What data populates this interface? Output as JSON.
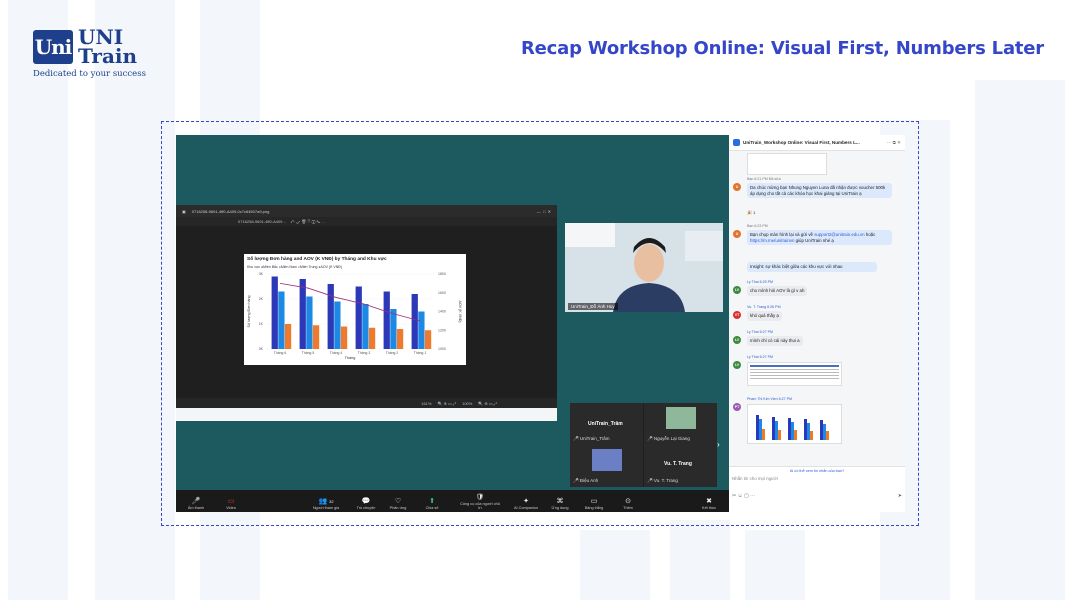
{
  "brand": {
    "logo_mark": "Uni",
    "logo_line1": "UNI",
    "logo_line2": "Train",
    "tagline": "Dedicated to your success"
  },
  "page_title": "Recap Workshop Online: Visual First, Numbers Later",
  "viewer": {
    "file_name": "0716258-9691-4ff0-A409-0c7c64507a9.png",
    "tab_name": "0716258-9691-4ff0-A409…",
    "zoom_left": "161%",
    "zoom_right": "100%"
  },
  "chart_data": {
    "type": "bar",
    "title": "Số lượng Đơn hàng and AOV (K VNĐ) by Tháng and Khu vực",
    "legend_title": "Khu vực",
    "categories": [
      "Tháng 6",
      "Tháng 5",
      "Tháng 4",
      "Tháng 3",
      "Tháng 2",
      "Tháng 1"
    ],
    "series": [
      {
        "name": "Miền Bắc",
        "values": [
          2.9,
          2.8,
          2.6,
          2.5,
          2.3,
          2.2
        ]
      },
      {
        "name": "Miền Nam",
        "values": [
          2.3,
          2.1,
          1.9,
          1.8,
          1.6,
          1.5
        ]
      },
      {
        "name": "Miền Trung",
        "values": [
          1.0,
          0.95,
          0.9,
          0.85,
          0.8,
          0.75
        ]
      }
    ],
    "line": {
      "name": "AOV (K VNĐ)",
      "values": [
        1700,
        1650,
        1550,
        1480,
        1380,
        1300
      ]
    },
    "xlabel": "Tháng",
    "ylabel": "Số lượng Đơn hàng",
    "y2label": "AOV (K VNĐ)",
    "y_ticks": [
      "0K",
      "1K",
      "2K",
      "3K"
    ],
    "y2_ticks": [
      "1000",
      "1200",
      "1400",
      "1600",
      "1800"
    ],
    "colors": {
      "Miền Bắc": "#2b39b8",
      "Miền Nam": "#1e88e5",
      "Miền Trung": "#f07a2c",
      "AOV (K VNĐ)": "#9c2c7a"
    }
  },
  "camera": {
    "name": "UniTrain_Đỗ Ánh Huy"
  },
  "tiles": [
    {
      "name": "UniTrain_Trâm",
      "label": "UniTrain_Trâm"
    },
    {
      "name": "",
      "label": "Nguyễn Lại Giang"
    },
    {
      "name": "",
      "label": "Điệu Anh"
    },
    {
      "name": "Vu. T. Trang",
      "label": "Vu. T. Trang"
    }
  ],
  "toolbar": [
    {
      "icon": "mic",
      "label": "Âm thanh"
    },
    {
      "icon": "video",
      "label": "Video"
    },
    {
      "icon": "participants",
      "label": "Người tham gia",
      "count": "32"
    },
    {
      "icon": "chat",
      "label": "Trò chuyện"
    },
    {
      "icon": "react",
      "label": "Phản ứng"
    },
    {
      "icon": "share",
      "label": "Chia sẻ"
    },
    {
      "icon": "host",
      "label": "Công cụ của người chủ trì"
    },
    {
      "icon": "ai",
      "label": "AI Companion"
    },
    {
      "icon": "apps",
      "label": "Ứng dụng"
    },
    {
      "icon": "whiteboard",
      "label": "Bảng trắng"
    },
    {
      "icon": "more",
      "label": "Thêm"
    },
    {
      "icon": "end",
      "label": "Kết thúc"
    }
  ],
  "chat": {
    "header": "UniTrain_Workshop Online: Visual First, Numbers L...",
    "messages": [
      {
        "meta": "Bạn 6:21 PM Đã sửa",
        "avatar": "U",
        "text": "Da chúc mừng bạn Nhung Nguyen Luna đã nhận được voucher 500k áp dụng cho tất cả các khóa học khai giảng tại UniTrain ạ",
        "reaction": "🎉 1"
      },
      {
        "meta": "Bạn 6:23 PM",
        "avatar": "U",
        "text_pre": "Bạn chụp màn hình lại và gửi về ",
        "link1": "support2@unitrain.edu.vn",
        "text_mid": " hoặc ",
        "link2": "https://m.me/unitrainvn",
        "text_post": " giúp UniTrain nhé ạ",
        "insight": "Insight: sự khác biệt giữa các khu vực với nhau"
      },
      {
        "meta": "Ly Thai 6:25 PM",
        "avatar": "LV",
        "text": "cho mình hỏi AOV là gì v ah"
      },
      {
        "meta": "Vu. T. Trang 6:26 PM",
        "avatar": "VT",
        "text": "khó quá thầy ạ"
      },
      {
        "meta": "Ly Thai 6:27 PM",
        "avatar": "LV",
        "text": "mình chỉ có cái này thui a"
      },
      {
        "meta": "Ly Thai 6:27 PM",
        "avatar": "LV",
        "text": ""
      },
      {
        "meta": "Pham Thi Kim Vien 6:27 PM",
        "avatar": "PT",
        "text": ""
      }
    ],
    "hint": "Ai có thể xem tin nhắn của bạn?",
    "input_placeholder": "Nhắn tin cho mọi người"
  }
}
